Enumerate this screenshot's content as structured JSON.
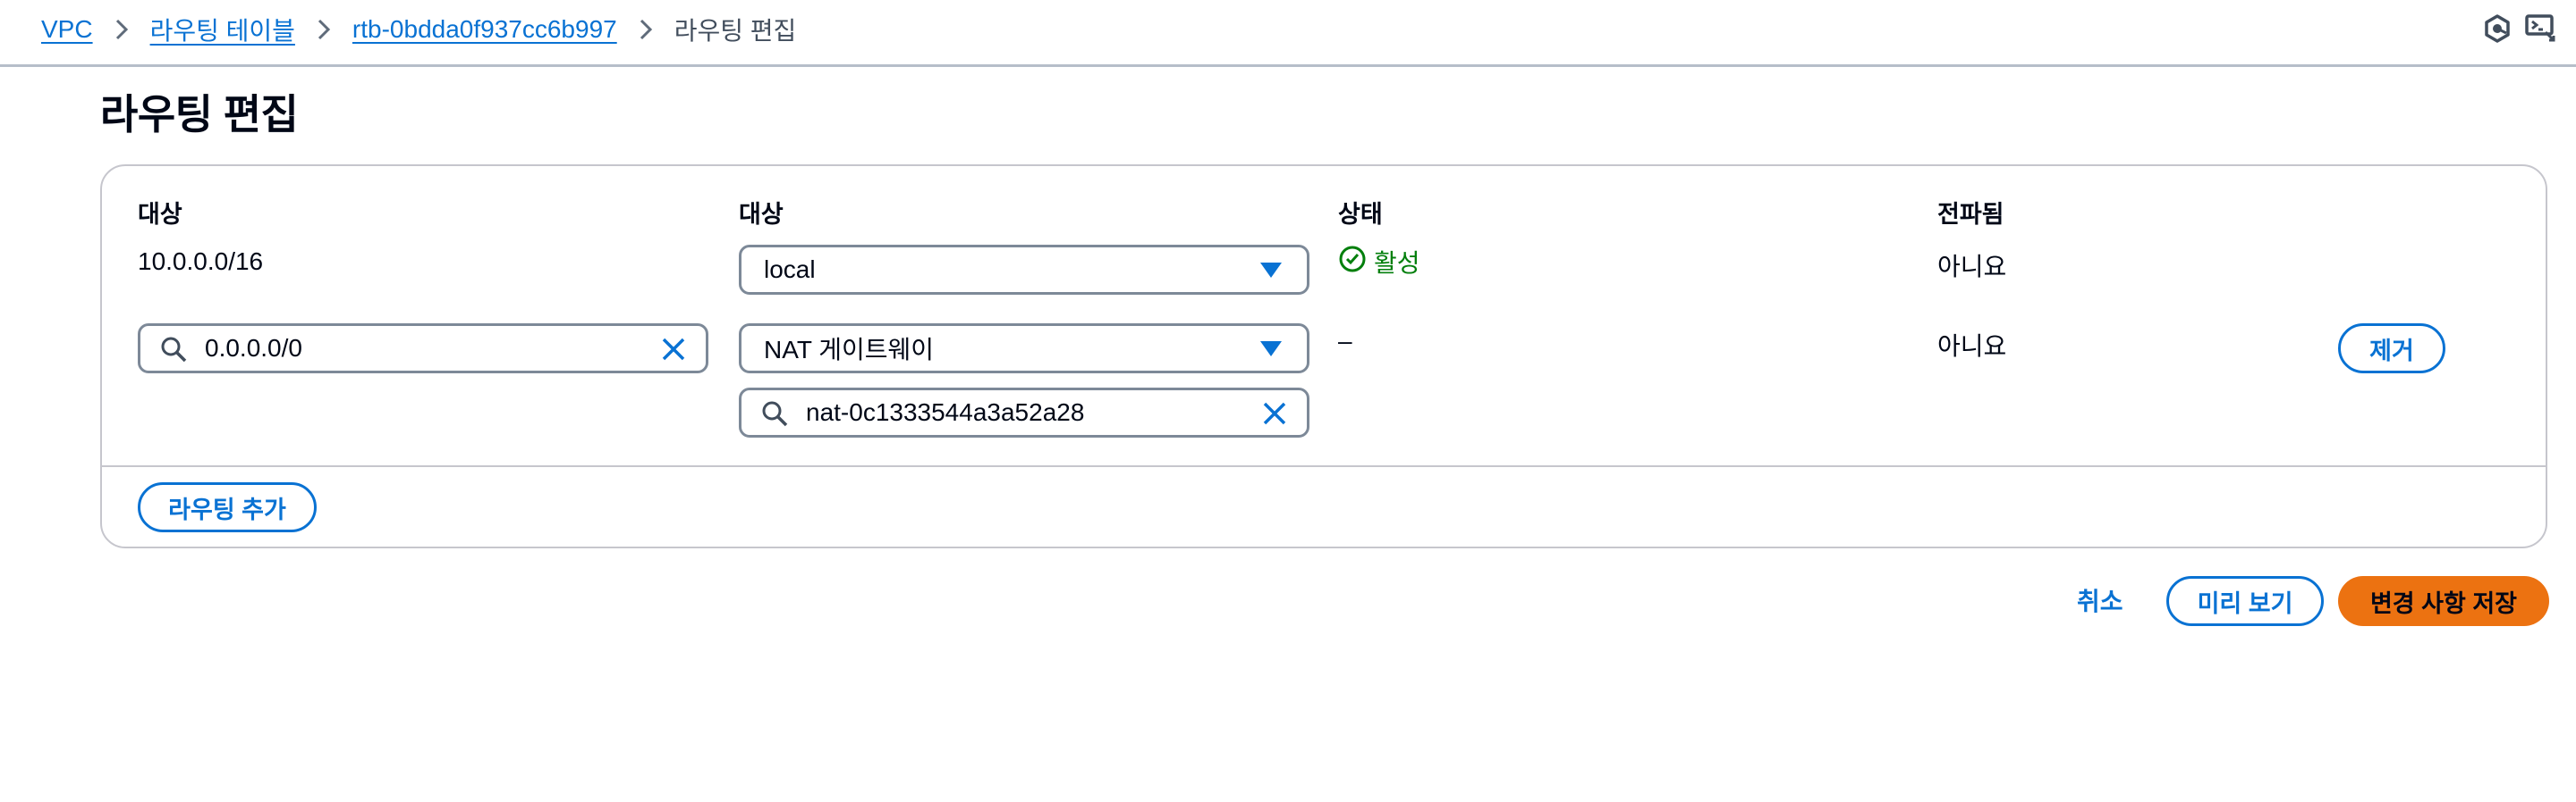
{
  "breadcrumb": {
    "items": [
      "VPC",
      "라우팅 테이블",
      "rtb-0bdda0f937cc6b997"
    ],
    "current": "라우팅 편집"
  },
  "page": {
    "title": "라우팅 편집"
  },
  "table": {
    "headers": [
      "대상",
      "대상",
      "상태",
      "전파됨"
    ],
    "rows": [
      {
        "destination": "10.0.0.0/16",
        "target": "local",
        "status": "활성",
        "propagated": "아니요"
      },
      {
        "destination": "0.0.0.0/0",
        "target": "NAT 게이트웨이",
        "target_id": "nat-0c1333544a3a52a28",
        "status": "–",
        "propagated": "아니요",
        "remove_label": "제거"
      }
    ],
    "add_route_label": "라우팅 추가"
  },
  "actions": {
    "cancel": "취소",
    "preview": "미리 보기",
    "save": "변경 사항 저장"
  },
  "colors": {
    "link": "#0972d3",
    "success": "#037f0c",
    "primary": "#ec7211"
  },
  "icons": {
    "top": [
      "notifications-icon",
      "cloudshell-icon"
    ]
  }
}
